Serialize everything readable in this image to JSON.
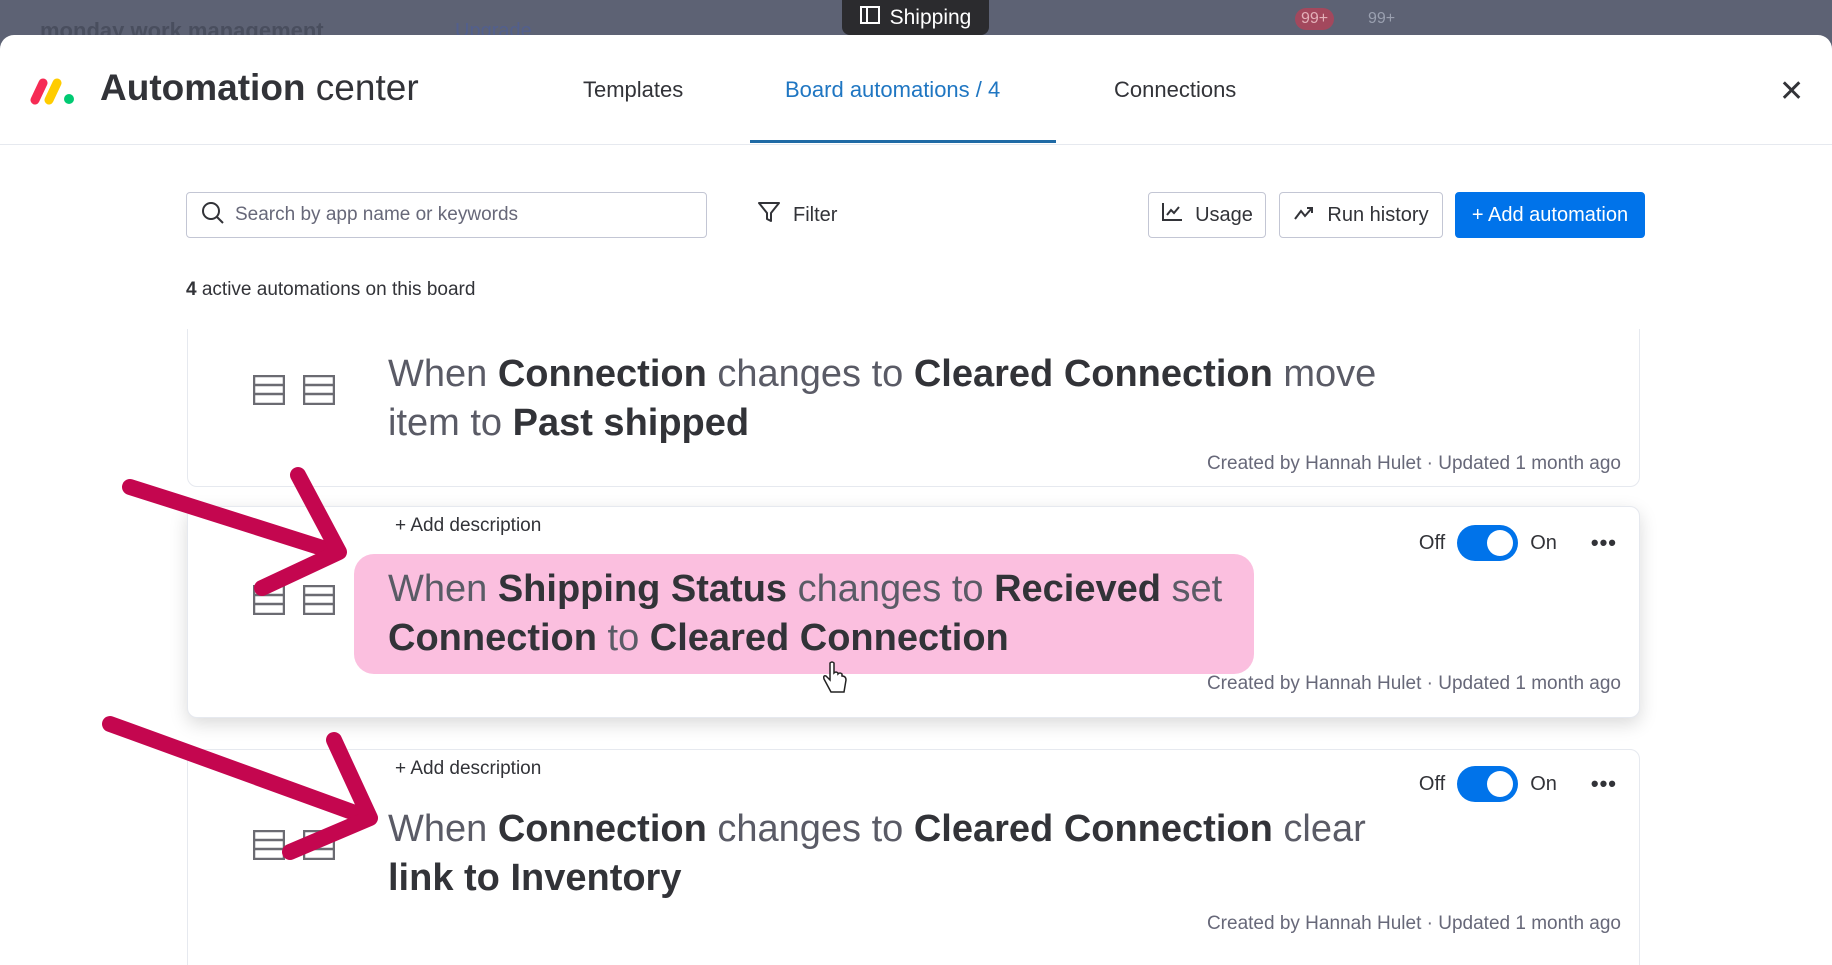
{
  "background": {
    "brand": "monday work management",
    "upgrade": "Upgrade",
    "badges": [
      "99+",
      "99+"
    ]
  },
  "tooltip": {
    "label": "Shipping"
  },
  "header": {
    "title_bold": "Automation",
    "title_light": " center",
    "tabs": [
      {
        "label": "Templates",
        "active": false
      },
      {
        "label": "Board automations / 4",
        "active": true
      },
      {
        "label": "Connections",
        "active": false
      }
    ],
    "close": "✕"
  },
  "toolbar": {
    "search_placeholder": "Search by app name or keywords",
    "filter": "Filter",
    "usage": "Usage",
    "run_history": "Run history",
    "add_automation": "+ Add automation"
  },
  "summary": {
    "count": "4",
    "text": " active automations on this board"
  },
  "automations": [
    {
      "lines": [
        [
          [
            "When ",
            false
          ],
          [
            "Connection",
            true
          ],
          [
            " changes to ",
            false
          ],
          [
            "Cleared Connection",
            true
          ],
          [
            " move",
            false
          ]
        ],
        [
          [
            "item to ",
            false
          ],
          [
            "Past shipped",
            true
          ]
        ]
      ],
      "meta": "Created by Hannah Hulet · Updated 1 month ago"
    },
    {
      "add_description": "+ Add description",
      "toggle": {
        "off": "Off",
        "on": "On",
        "enabled": true
      },
      "highlighted": true,
      "lines": [
        [
          [
            "When ",
            false
          ],
          [
            "Shipping Status",
            true
          ],
          [
            " changes to ",
            false
          ],
          [
            "Recieved",
            true
          ],
          [
            " set",
            false
          ]
        ],
        [
          [
            "Connection",
            true
          ],
          [
            " to ",
            false
          ],
          [
            "Cleared Connection",
            true
          ]
        ]
      ],
      "meta": "Created by Hannah Hulet · Updated 1 month ago"
    },
    {
      "add_description": "+ Add description",
      "toggle": {
        "off": "Off",
        "on": "On",
        "enabled": true
      },
      "lines": [
        [
          [
            "When ",
            false
          ],
          [
            "Connection",
            true
          ],
          [
            " changes to ",
            false
          ],
          [
            "Cleared Connection",
            true
          ],
          [
            " clear",
            false
          ]
        ],
        [
          [
            "link to Inventory",
            true
          ]
        ]
      ],
      "meta": "Created by Hannah Hulet · Updated 1 month ago"
    }
  ],
  "colors": {
    "accent": "#0073ea",
    "tab_active": "#1f76c2",
    "highlight": "#fbbfdf",
    "annotation_arrow": "#c4064f"
  }
}
